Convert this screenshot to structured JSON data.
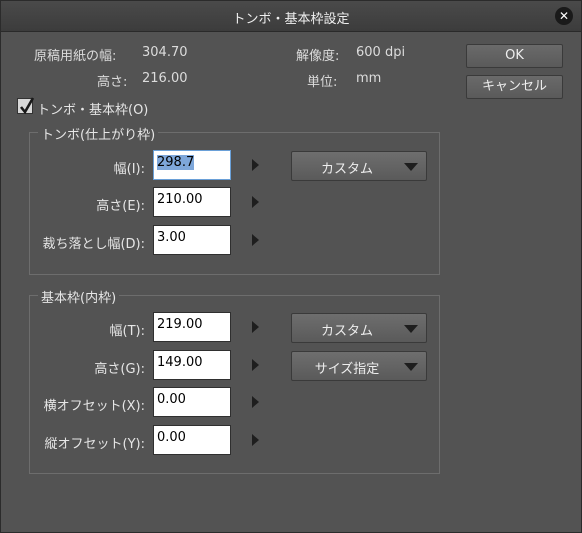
{
  "window": {
    "title": "トンボ・基本枠設定",
    "close_glyph": "✕"
  },
  "info": {
    "paper_width_label": "原稿用紙の幅:",
    "paper_width_value": "304.70",
    "paper_height_label": "高さ:",
    "paper_height_value": "216.00",
    "resolution_label": "解像度:",
    "resolution_value": "600 dpi",
    "unit_label": "単位:",
    "unit_value": "mm"
  },
  "buttons": {
    "ok": "OK",
    "cancel": "キャンセル"
  },
  "checkbox": {
    "label": "トンボ・基本枠(O)",
    "checked": true
  },
  "trim_group": {
    "title": "トンボ(仕上がり枠)",
    "width_label": "幅(I):",
    "width_value": "298.7",
    "height_label": "高さ(E):",
    "height_value": "210.00",
    "bleed_label": "裁ち落とし幅(D):",
    "bleed_value": "3.00",
    "preset_label": "カスタム"
  },
  "base_group": {
    "title": "基本枠(内枠)",
    "width_label": "幅(T):",
    "width_value": "219.00",
    "height_label": "高さ(G):",
    "height_value": "149.00",
    "xoffset_label": "横オフセット(X):",
    "xoffset_value": "0.00",
    "yoffset_label": "縦オフセット(Y):",
    "yoffset_value": "0.00",
    "preset_label": "カスタム",
    "size_mode_label": "サイズ指定"
  }
}
